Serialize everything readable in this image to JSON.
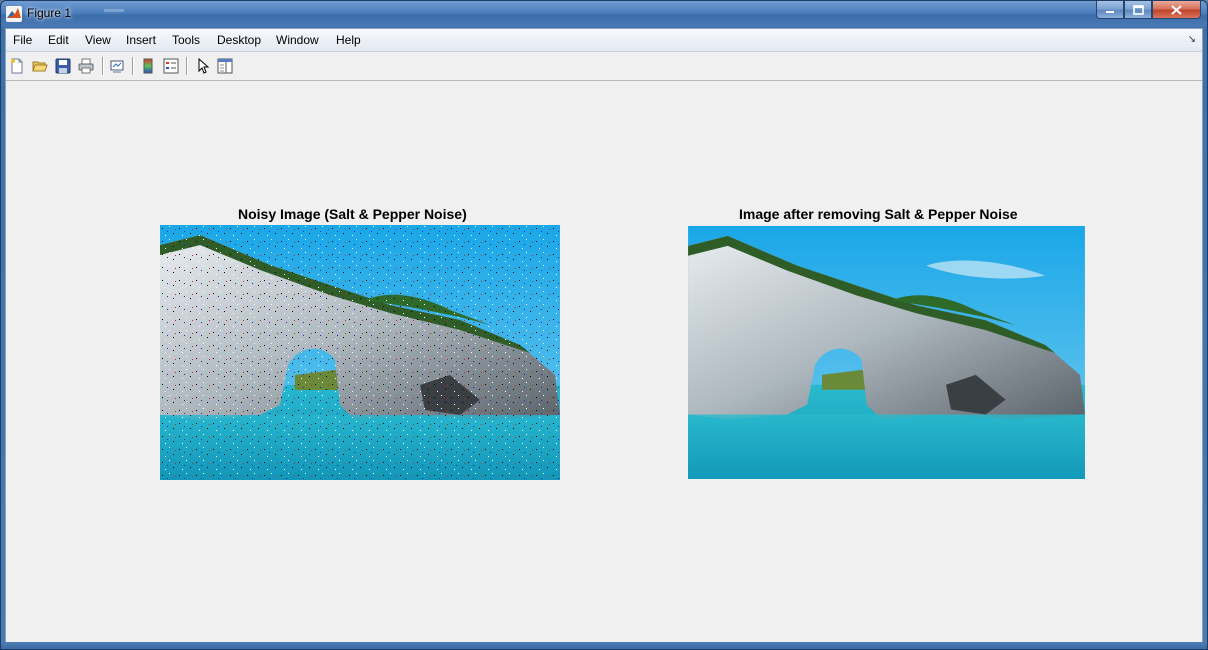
{
  "window": {
    "title": "Figure 1",
    "controls": {
      "minimize": "—",
      "maximize": "□",
      "close": "✕"
    }
  },
  "menubar": {
    "items": [
      "File",
      "Edit",
      "View",
      "Insert",
      "Tools",
      "Desktop",
      "Window",
      "Help"
    ],
    "dock_icon": "↘"
  },
  "toolbar": {
    "buttons": [
      "new-figure-icon",
      "open-file-icon",
      "save-icon",
      "print-icon",
      "link-plot-icon",
      "colorbar-icon",
      "legend-icon",
      "pointer-icon",
      "property-editor-icon"
    ]
  },
  "axes": [
    {
      "title": "Noisy Image (Salt & Pepper  Noise)",
      "image": "noisy-sea-arch-photo"
    },
    {
      "title": "Image after removing Salt & Pepper  Noise",
      "image": "denoised-sea-arch-photo"
    }
  ]
}
